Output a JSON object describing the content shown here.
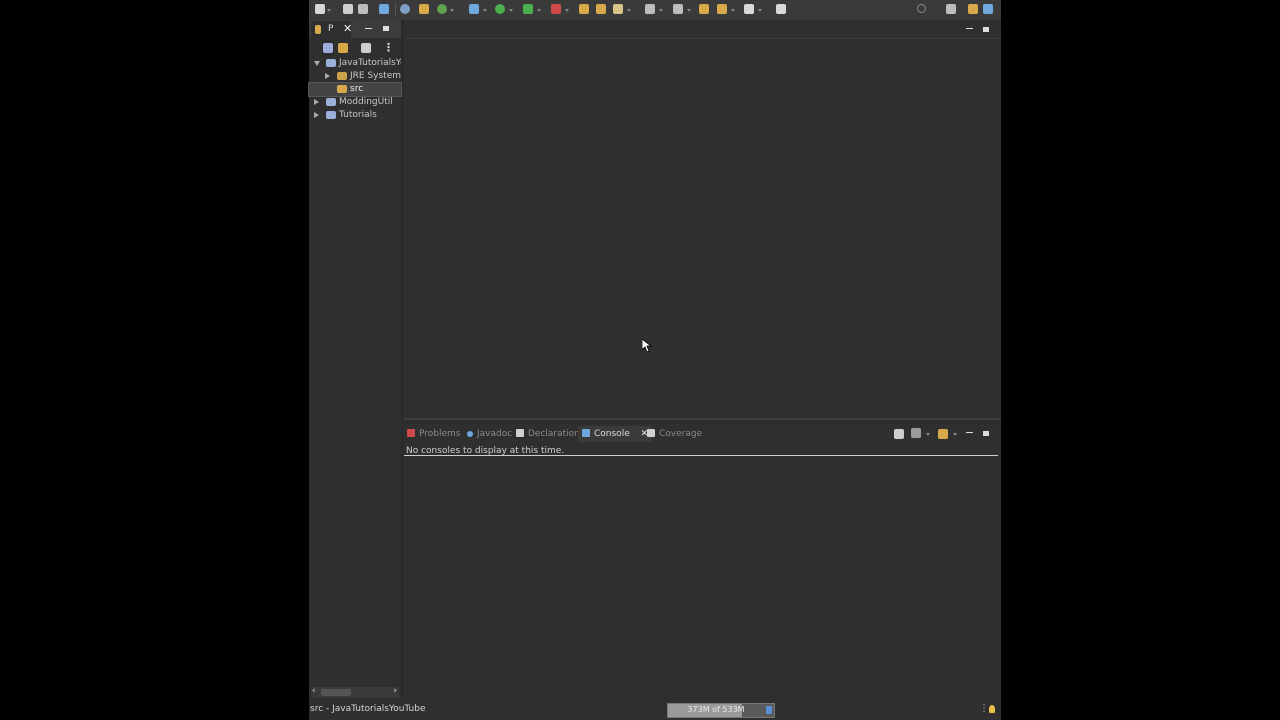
{
  "package_explorer": {
    "tab_label": "P",
    "tree": [
      {
        "label": "JavaTutorialsYo",
        "expanded": true
      },
      {
        "label": "JRE System L"
      },
      {
        "label": "src",
        "selected": true
      },
      {
        "label": "ModdingUtil"
      },
      {
        "label": "Tutorials"
      }
    ]
  },
  "bottom_panel": {
    "tabs": [
      {
        "label": "Problems"
      },
      {
        "label": "Javadoc"
      },
      {
        "label": "Declaration"
      },
      {
        "label": "Console",
        "active": true
      },
      {
        "label": "Coverage"
      }
    ],
    "console_message": "No consoles to display at this time."
  },
  "status_bar": {
    "selection_text": "src - JavaTutorialsYouTube",
    "heap_label": "373M of 533M",
    "heap_used_fraction": 0.7
  },
  "icons": {
    "colors": {
      "folder": "#d7a94b",
      "project": "#9ab0d8",
      "library": "#c9a24a",
      "run": "#4caf50",
      "debug": "#6fa8dc",
      "error": "#d04a4a",
      "console": "#6fa8dc"
    }
  }
}
